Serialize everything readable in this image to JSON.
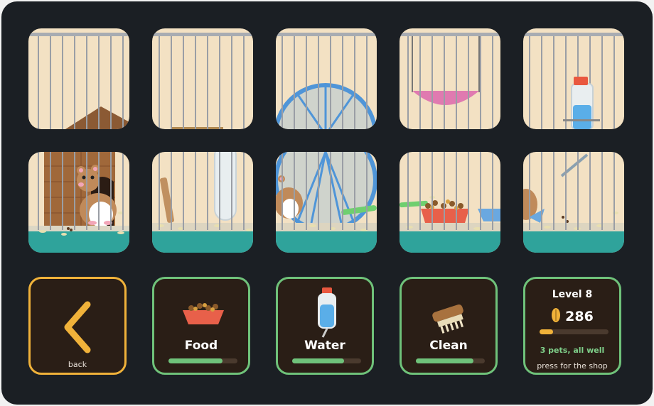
{
  "controls": {
    "back": {
      "label": "back"
    },
    "food": {
      "label": "Food",
      "level": 0.78
    },
    "water": {
      "label": "Water",
      "level": 0.75
    },
    "clean": {
      "label": "Clean",
      "level": 0.83
    }
  },
  "status": {
    "level_label": "Level 8",
    "coins": "286",
    "xp_progress": 0.2,
    "pets_status": "3 pets, all well",
    "shop_hint": "press for the shop"
  },
  "colors": {
    "back_border": "#f0b23a",
    "green_border": "#6fc27a",
    "pets_status_text": "#7fd08a",
    "key_background": "#2a1e16"
  }
}
